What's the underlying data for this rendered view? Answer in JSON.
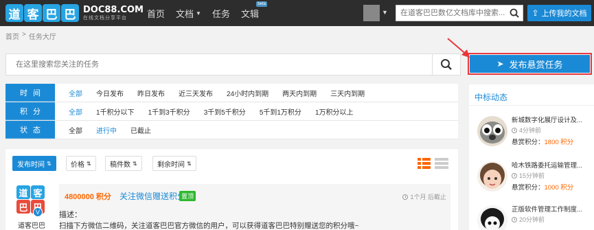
{
  "header": {
    "logo_chars": [
      "道",
      "客",
      "巴",
      "巴"
    ],
    "logo_domain": "DOC88.COM",
    "logo_slogan": "在线文档分享平台",
    "nav": [
      {
        "label": "首页"
      },
      {
        "label": "文档",
        "dropdown": true
      },
      {
        "label": "任务"
      },
      {
        "label": "文辑",
        "badge": "beta"
      }
    ],
    "search_placeholder": "在道客巴巴数亿文档库中搜索...",
    "upload_label": "上传我的文档"
  },
  "breadcrumb": [
    "首页",
    ">",
    "任务大厅"
  ],
  "task_search": {
    "placeholder": "在这里搜索您关注的任务"
  },
  "publish_button": "发布悬赏任务",
  "filters": [
    {
      "label": "时间",
      "options": [
        "全部",
        "今日发布",
        "昨日发布",
        "近三天发布",
        "24小时内到期",
        "两天内到期",
        "三天内到期"
      ],
      "active": 0
    },
    {
      "label": "积分",
      "options": [
        "全部",
        "1千积分以下",
        "1千到3千积分",
        "3千到5千积分",
        "5千到1万积分",
        "1万积分以上"
      ],
      "active": 0
    },
    {
      "label": "状态",
      "options": [
        "全部",
        "进行中",
        "已截止"
      ],
      "active": 1
    }
  ],
  "sort_buttons": [
    "发布时间",
    "价格",
    "稿件数",
    "剩余时间"
  ],
  "task": {
    "publisher": "道客巴巴",
    "points": "4800000 积分",
    "title": "关注微信赠送积分",
    "badge": "置顶",
    "time": "1个月 后截止",
    "desc_label": "描述：",
    "desc": "扫描下方微信二维码，关注道客巴巴官方微信的用户，可以获得道客巴巴特别赠送您的积分哦~"
  },
  "winners": {
    "title": "中标动态",
    "reward_label": "悬赏积分：",
    "items": [
      {
        "name": "新城数字化展厅设计及...",
        "when": "4分钟前",
        "amount": "1800 积分"
      },
      {
        "name": "哈木铁路委托运输管理...",
        "when": "15分钟前",
        "amount": "1000 积分"
      },
      {
        "name": "正版软件管理工作制度...",
        "when": "20分钟前",
        "amount": ""
      }
    ]
  },
  "colors": {
    "brand": "#1b8ad6",
    "highlight_border": "#e8383d",
    "points": "#ff6600",
    "topbar": "#2d2d2d"
  }
}
